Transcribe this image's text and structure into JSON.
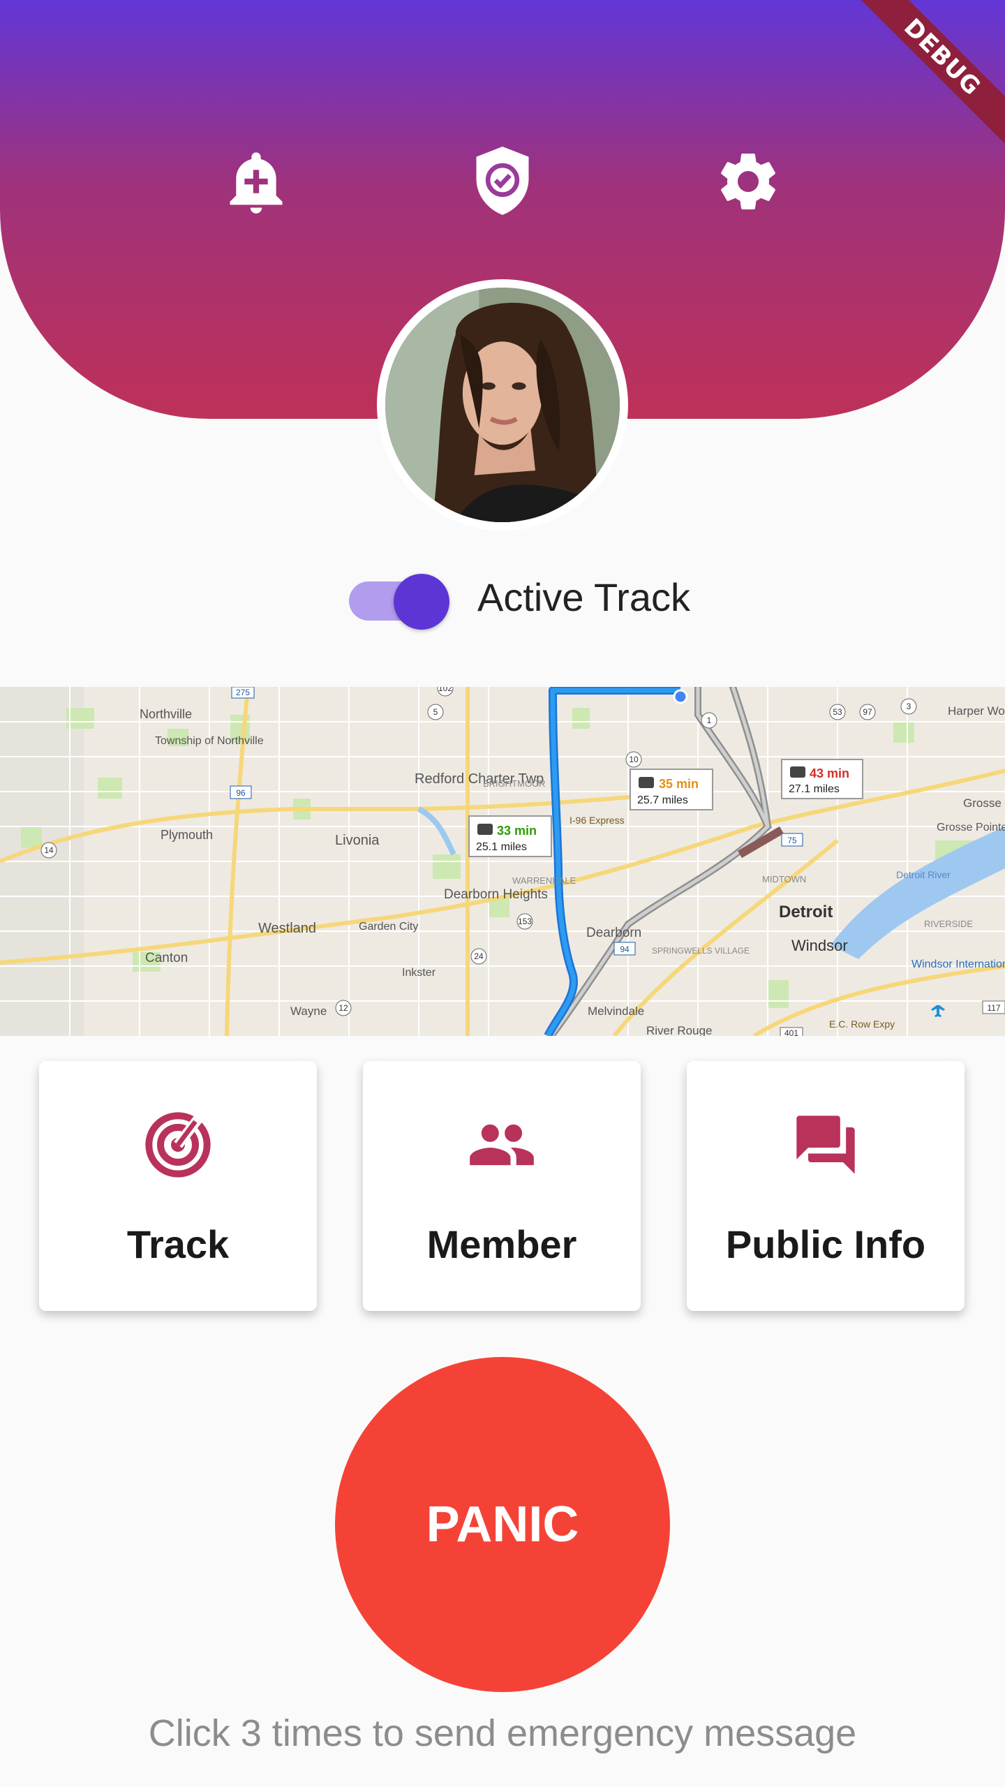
{
  "header": {
    "icons": [
      "add-alert-icon",
      "shield-check-icon",
      "gear-icon"
    ],
    "gradient": [
      "#6236d6",
      "#be3158"
    ],
    "debug_banner": "DEBUG"
  },
  "profile": {
    "avatar": "profile-photo"
  },
  "tracking": {
    "label": "Active Track",
    "enabled": true,
    "accent": "#5e35d5"
  },
  "map": {
    "places": [
      "Northville",
      "Township of Northville",
      "Redford Charter Twp",
      "BRIGHTMOOR",
      "Plymouth",
      "Livonia",
      "Westland",
      "Garden City",
      "Dearborn Heights",
      "Dearborn",
      "Canton",
      "Inkster",
      "Wayne",
      "Detroit",
      "Windsor",
      "Melvindale",
      "River Rouge",
      "MIDTOWN",
      "WARRENDALE",
      "SPRINGWELLS VILLAGE",
      "Harper Woo",
      "Grosse",
      "Grosse Pointe Park",
      "RIVERSIDE",
      "Windsor International Airport",
      "Detroit River",
      "I-96 Express",
      "E.C. Row Expy"
    ],
    "routes": [
      {
        "time": "33 min",
        "distance": "25.1 miles",
        "color": "#2e9b0a"
      },
      {
        "time": "35 min",
        "distance": "25.7 miles",
        "color": "#e8900c"
      },
      {
        "time": "43 min",
        "distance": "27.1 miles",
        "color": "#d0302a"
      }
    ],
    "shields": [
      "275",
      "96",
      "14",
      "5",
      "102",
      "153",
      "24",
      "12",
      "94",
      "75",
      "10",
      "1",
      "53",
      "97",
      "3",
      "401",
      "117"
    ]
  },
  "actions": [
    {
      "label": "Track",
      "icon": "radar-icon"
    },
    {
      "label": "Member",
      "icon": "group-icon"
    },
    {
      "label": "Public Info",
      "icon": "forum-icon"
    }
  ],
  "panic": {
    "label": "PANIC",
    "color": "#f44336"
  },
  "hint": "Click 3 times to send emergency message"
}
